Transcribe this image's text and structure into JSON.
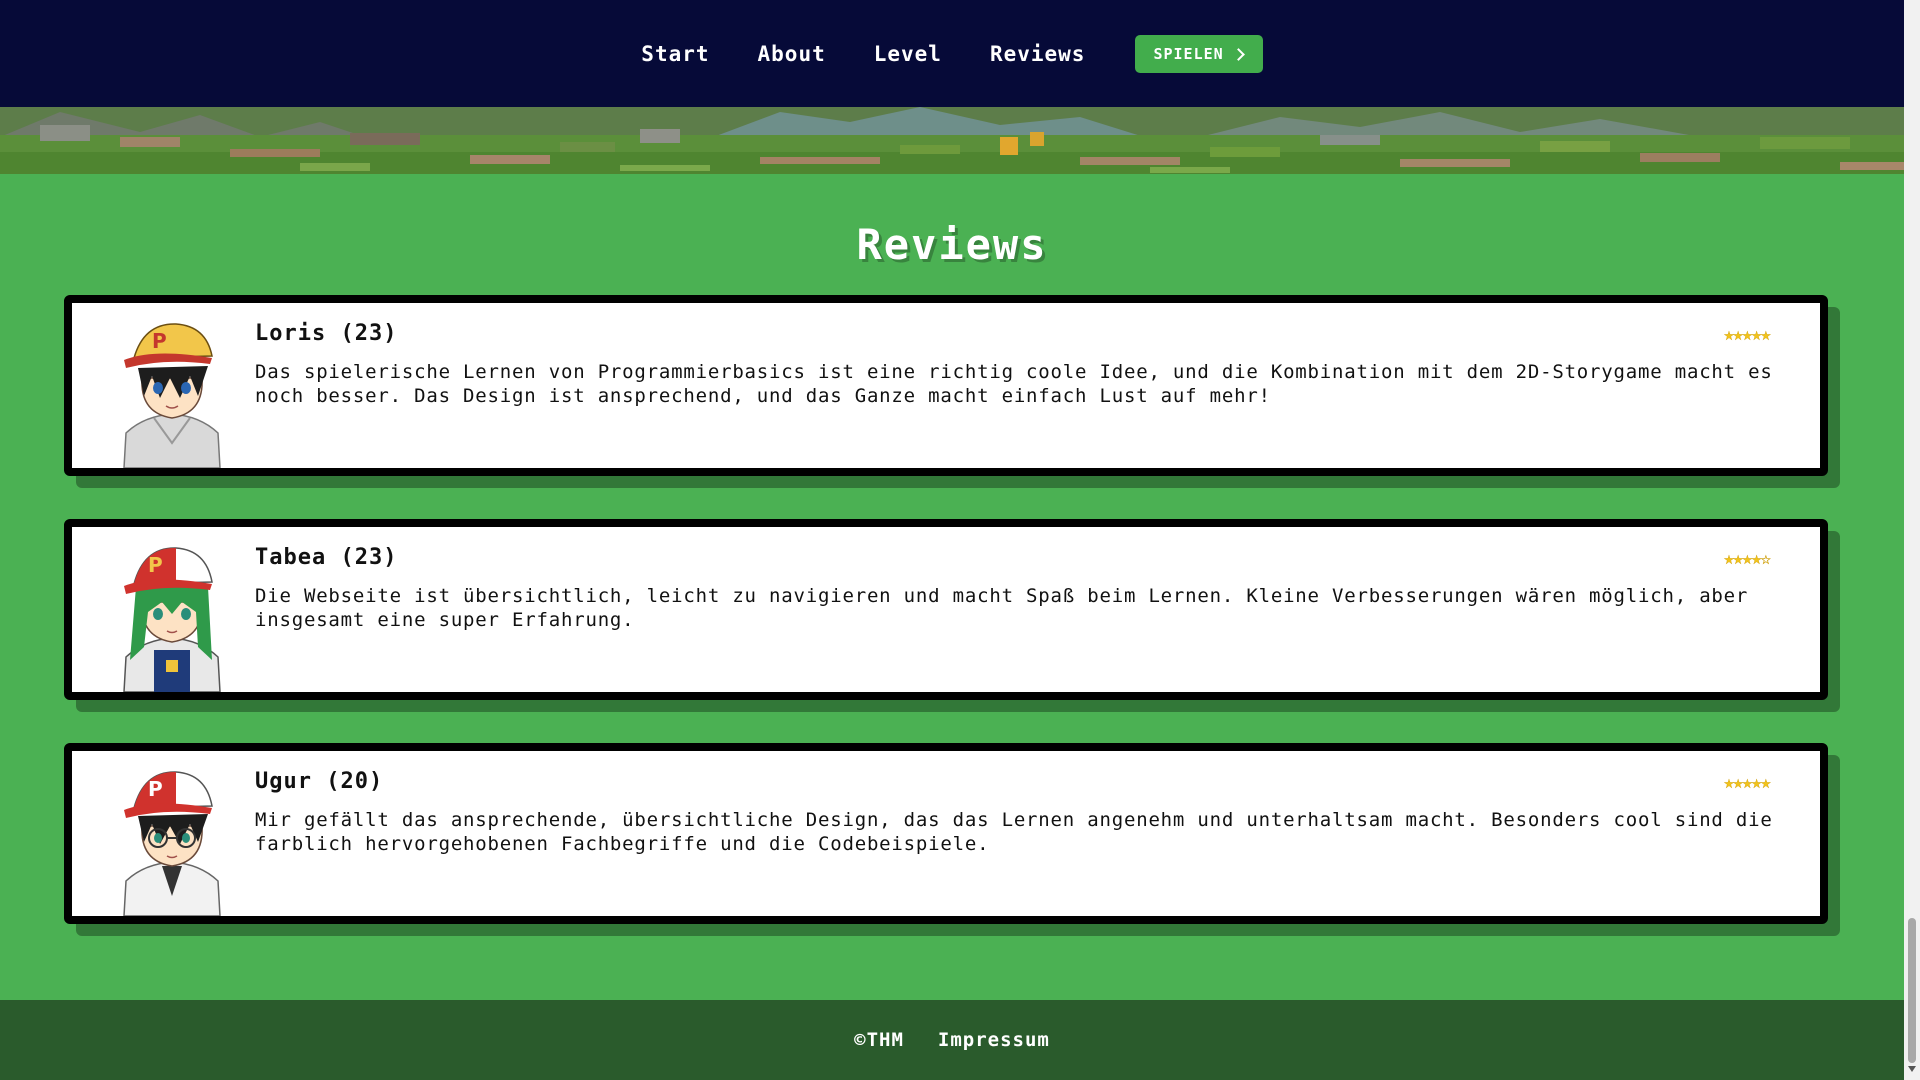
{
  "nav": {
    "links": [
      {
        "label": "Start"
      },
      {
        "label": "About"
      },
      {
        "label": "Level"
      },
      {
        "label": "Reviews"
      }
    ],
    "cta_label": "SPIELEN"
  },
  "reviews_section": {
    "title": "Reviews",
    "items": [
      {
        "name": "Loris (23)",
        "stars": "★★★★★",
        "rating": 5,
        "text": "Das spielerische Lernen von Programmierbasics ist eine richtig coole Idee, und die Kombination mit dem 2D-Storygame macht es noch besser. Das Design ist ansprechend, und das Ganze macht einfach Lust auf mehr!",
        "avatar_icon": "avatar-boy-yellow-cap-icon"
      },
      {
        "name": "Tabea (23)",
        "stars": "★★★★☆",
        "rating": 4,
        "text": "Die Webseite ist übersichtlich, leicht zu navigieren und macht Spaß beim Lernen. Kleine Verbesserungen wären möglich, aber insgesamt eine super Erfahrung.",
        "avatar_icon": "avatar-girl-green-hair-icon"
      },
      {
        "name": "Ugur (20)",
        "stars": "★★★★★",
        "rating": 5,
        "text": "Mir gefällt das ansprechende, übersichtliche Design, das das Lernen angenehm und unterhaltsam macht. Besonders cool sind die farblich hervorgehobenen Fachbegriffe und die Codebeispiele.",
        "avatar_icon": "avatar-boy-glasses-icon"
      }
    ]
  },
  "footer": {
    "copyright": "©THM",
    "impressum": "Impressum"
  },
  "colors": {
    "nav_bg": "#060a38",
    "accent_green": "#42ad4c",
    "section_bg": "#4bb153",
    "footer_bg": "#2a5b2c",
    "star": "#f2c31b"
  }
}
